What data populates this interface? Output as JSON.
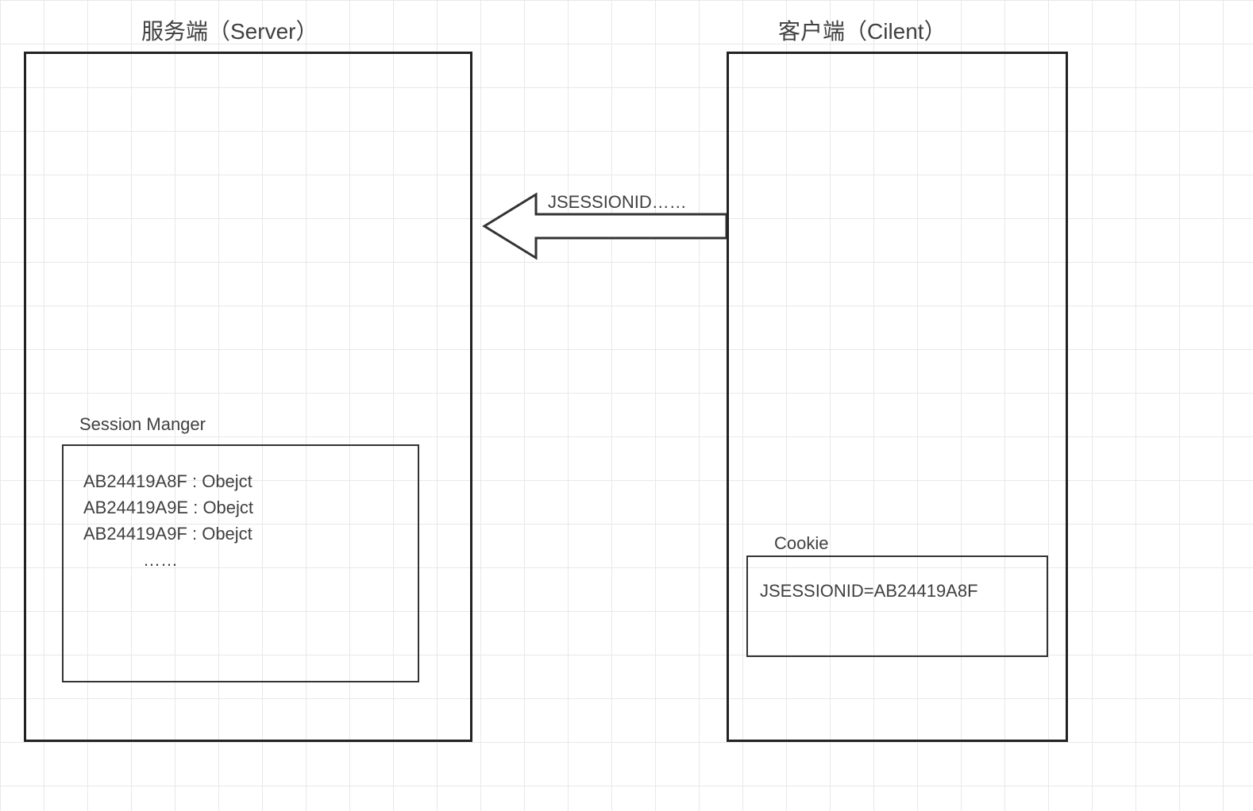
{
  "server": {
    "title": "服务端（Server）",
    "session_manager": {
      "label": "Session Manger",
      "entries": [
        "AB24419A8F : Obejct",
        "AB24419A9E : Obejct",
        "AB24419A9F : Obejct"
      ],
      "ellipsis": "……"
    }
  },
  "client": {
    "title": "客户端（Cilent）",
    "cookie": {
      "label": "Cookie",
      "content": "JSESSIONID=AB24419A8F"
    }
  },
  "arrow": {
    "label": "JSESSIONID……"
  }
}
